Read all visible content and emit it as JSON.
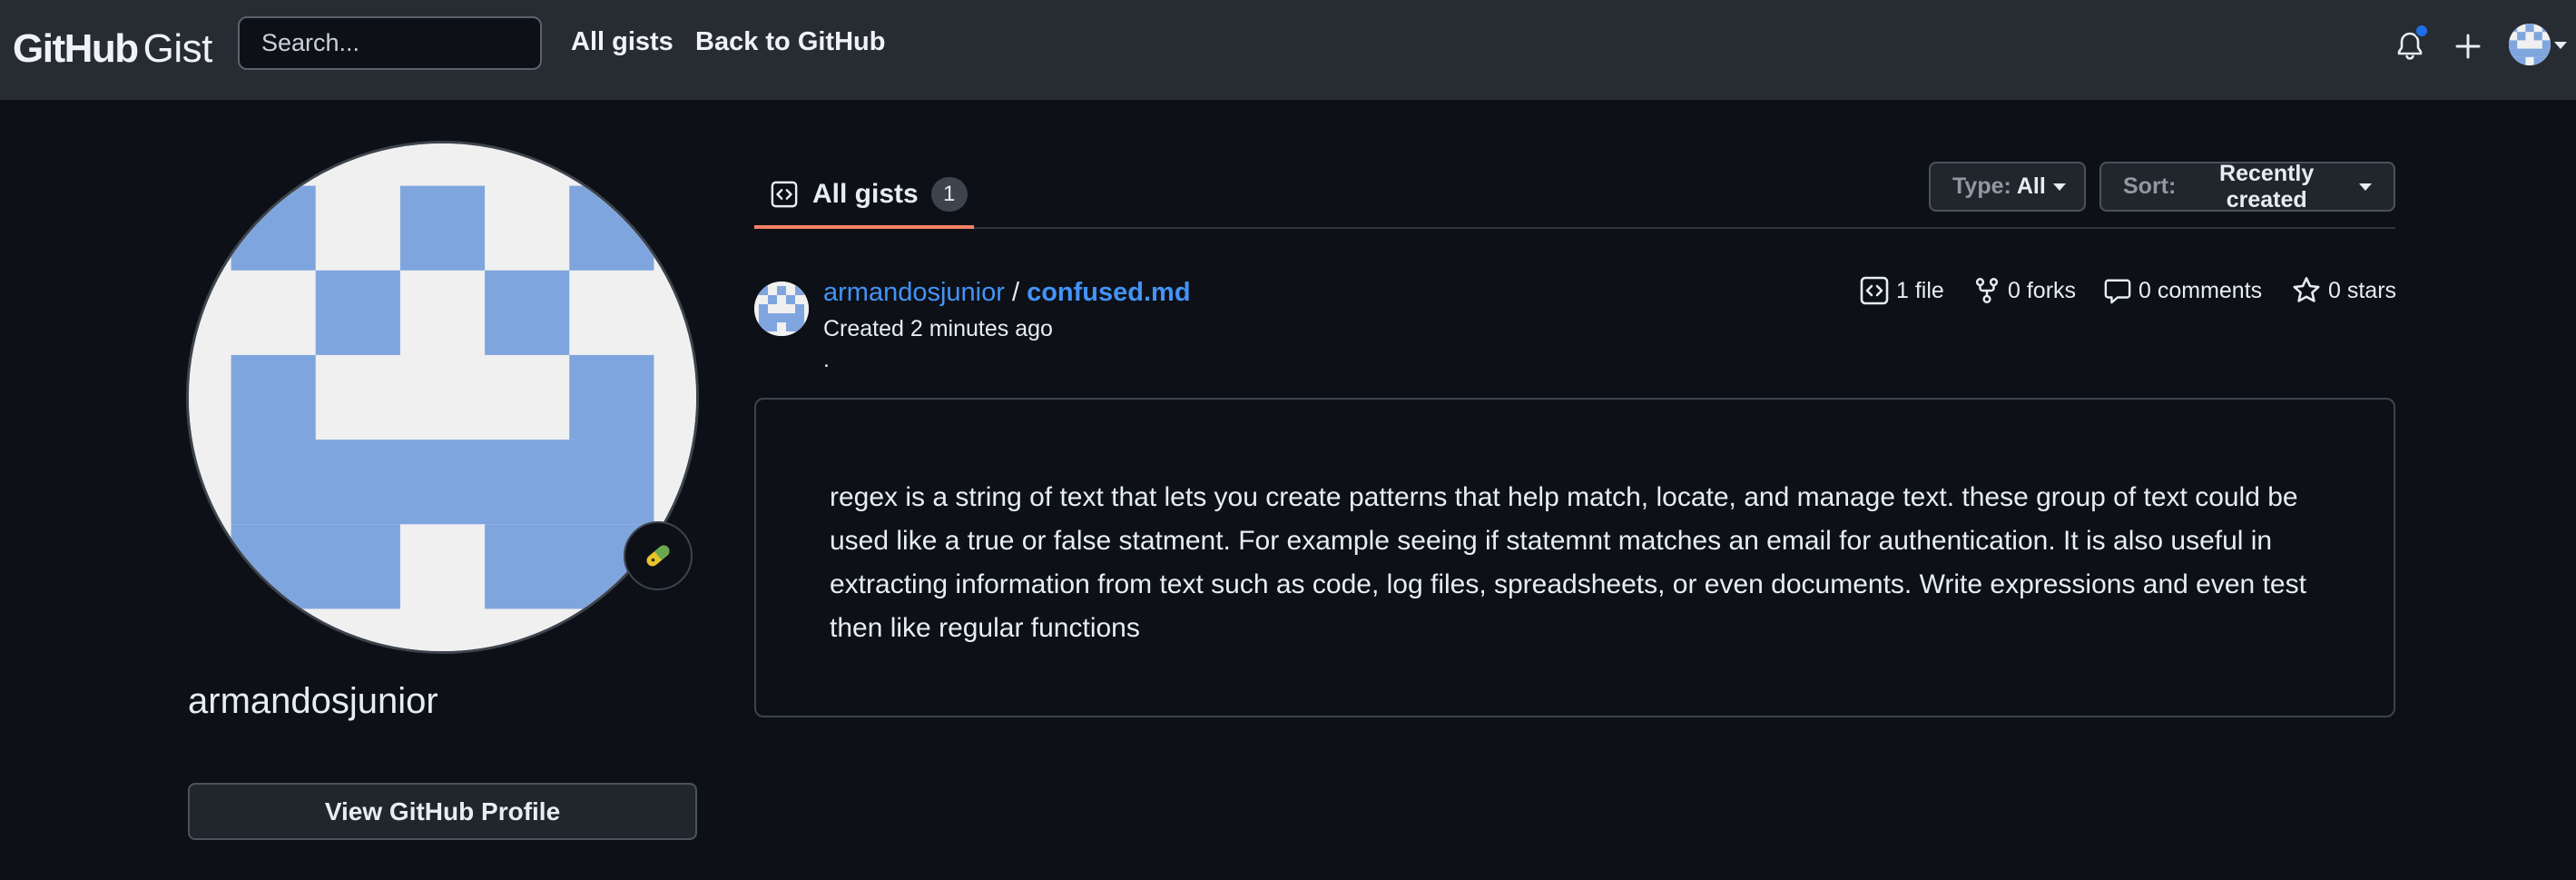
{
  "header": {
    "logo_primary": "GitHub",
    "logo_secondary": "Gist",
    "search_placeholder": "Search...",
    "nav": [
      {
        "label": "All gists"
      },
      {
        "label": "Back to GitHub"
      }
    ],
    "notification_dot_color": "#1f6feb",
    "icons": [
      "bell-icon",
      "plus-icon",
      "user-avatar",
      "caret-down-icon"
    ]
  },
  "profile": {
    "username": "armandosjunior",
    "view_profile_label": "View GitHub Profile",
    "status_emoji": "pill",
    "avatar_colors": {
      "fill": "#7fa5de",
      "background": "#f0f0f0"
    }
  },
  "tabs": {
    "all_gists_label": "All gists",
    "all_gists_count": "1",
    "accent": "#f78166"
  },
  "filters": {
    "type_label": "Type:",
    "type_value": "All",
    "sort_label": "Sort:",
    "sort_value": "Recently created"
  },
  "gist": {
    "owner": "armandosjunior",
    "separator": "/",
    "filename": "confused.md",
    "created": "Created 2 minutes ago",
    "description": ".",
    "stats": {
      "files": "1 file",
      "forks": "0 forks",
      "comments": "0 comments",
      "stars": "0 stars"
    },
    "content": "regex is a string of text that lets you create patterns that help match, locate, and manage text. these group of text could be used like a true or false statment. For example seeing if statemnt matches an email for authentication. It is also useful in extracting information from text such as code, log files, spreadsheets, or even documents. Write expressions and even test then like regular functions"
  }
}
